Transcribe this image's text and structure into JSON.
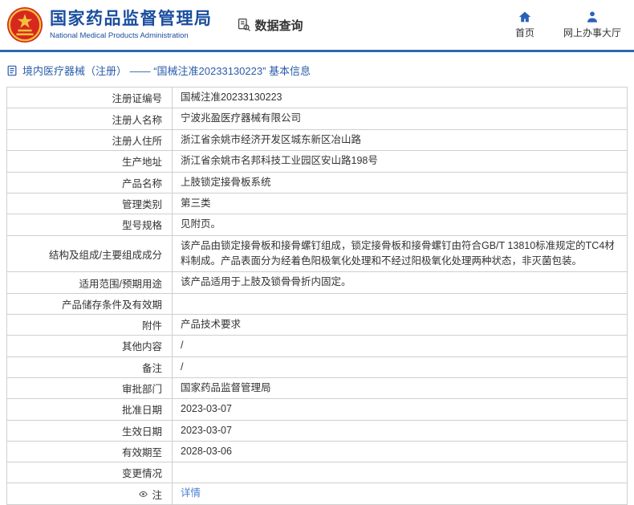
{
  "header": {
    "org_name_cn": "国家药品监督管理局",
    "org_name_en": "National Medical Products Administration",
    "section_title": "数据查询",
    "nav": [
      {
        "label": "首页",
        "icon": "home-icon"
      },
      {
        "label": "网上办事大厅",
        "icon": "person-icon"
      }
    ]
  },
  "breadcrumb": {
    "text": "境内医疗器械（注册） ——  “国械注准20233130223”  基本信息"
  },
  "table": {
    "rows": [
      {
        "label": "注册证编号",
        "value": "国械注准20233130223"
      },
      {
        "label": "注册人名称",
        "value": "宁波兆盈医疗器械有限公司"
      },
      {
        "label": "注册人住所",
        "value": "浙江省余姚市经济开发区城东新区冶山路"
      },
      {
        "label": "生产地址",
        "value": "浙江省余姚市名邦科技工业园区安山路198号"
      },
      {
        "label": "产品名称",
        "value": "上肢锁定接骨板系统"
      },
      {
        "label": "管理类别",
        "value": "第三类"
      },
      {
        "label": "型号规格",
        "value": "见附页。"
      },
      {
        "label": "结构及组成/主要组成成分",
        "value": "该产品由锁定接骨板和接骨螺钉组成，锁定接骨板和接骨螺钉由符合GB/T 13810标准规定的TC4材料制成。产品表面分为经着色阳极氧化处理和不经过阳极氧化处理两种状态，非灭菌包装。"
      },
      {
        "label": "适用范围/预期用途",
        "value": "该产品适用于上肢及锁骨骨折内固定。"
      },
      {
        "label": "产品储存条件及有效期",
        "value": ""
      },
      {
        "label": "附件",
        "value": "产品技术要求"
      },
      {
        "label": "其他内容",
        "value": "/"
      },
      {
        "label": "备注",
        "value": "/"
      },
      {
        "label": "审批部门",
        "value": "国家药品监督管理局"
      },
      {
        "label": "批准日期",
        "value": "2023-03-07"
      },
      {
        "label": "生效日期",
        "value": "2023-03-07"
      },
      {
        "label": "有效期至",
        "value": "2028-03-06"
      },
      {
        "label": "变更情况",
        "value": ""
      },
      {
        "label": "注",
        "value": "详情"
      }
    ]
  },
  "icons": {
    "logo": "national-emblem",
    "section": "document-search-icon",
    "nav_home": "home-icon",
    "nav_service": "person-icon",
    "breadcrumb": "document-icon",
    "note": "eye-icon"
  },
  "colors": {
    "brand_blue": "#1a4e9e",
    "divider_blue": "#3166b0",
    "breadcrumb_blue": "#2a5caa",
    "link_blue": "#4a7fd0",
    "emblem_red": "#d7281f",
    "emblem_gold": "#f3c13a",
    "border_gray": "#cfcfcf"
  }
}
